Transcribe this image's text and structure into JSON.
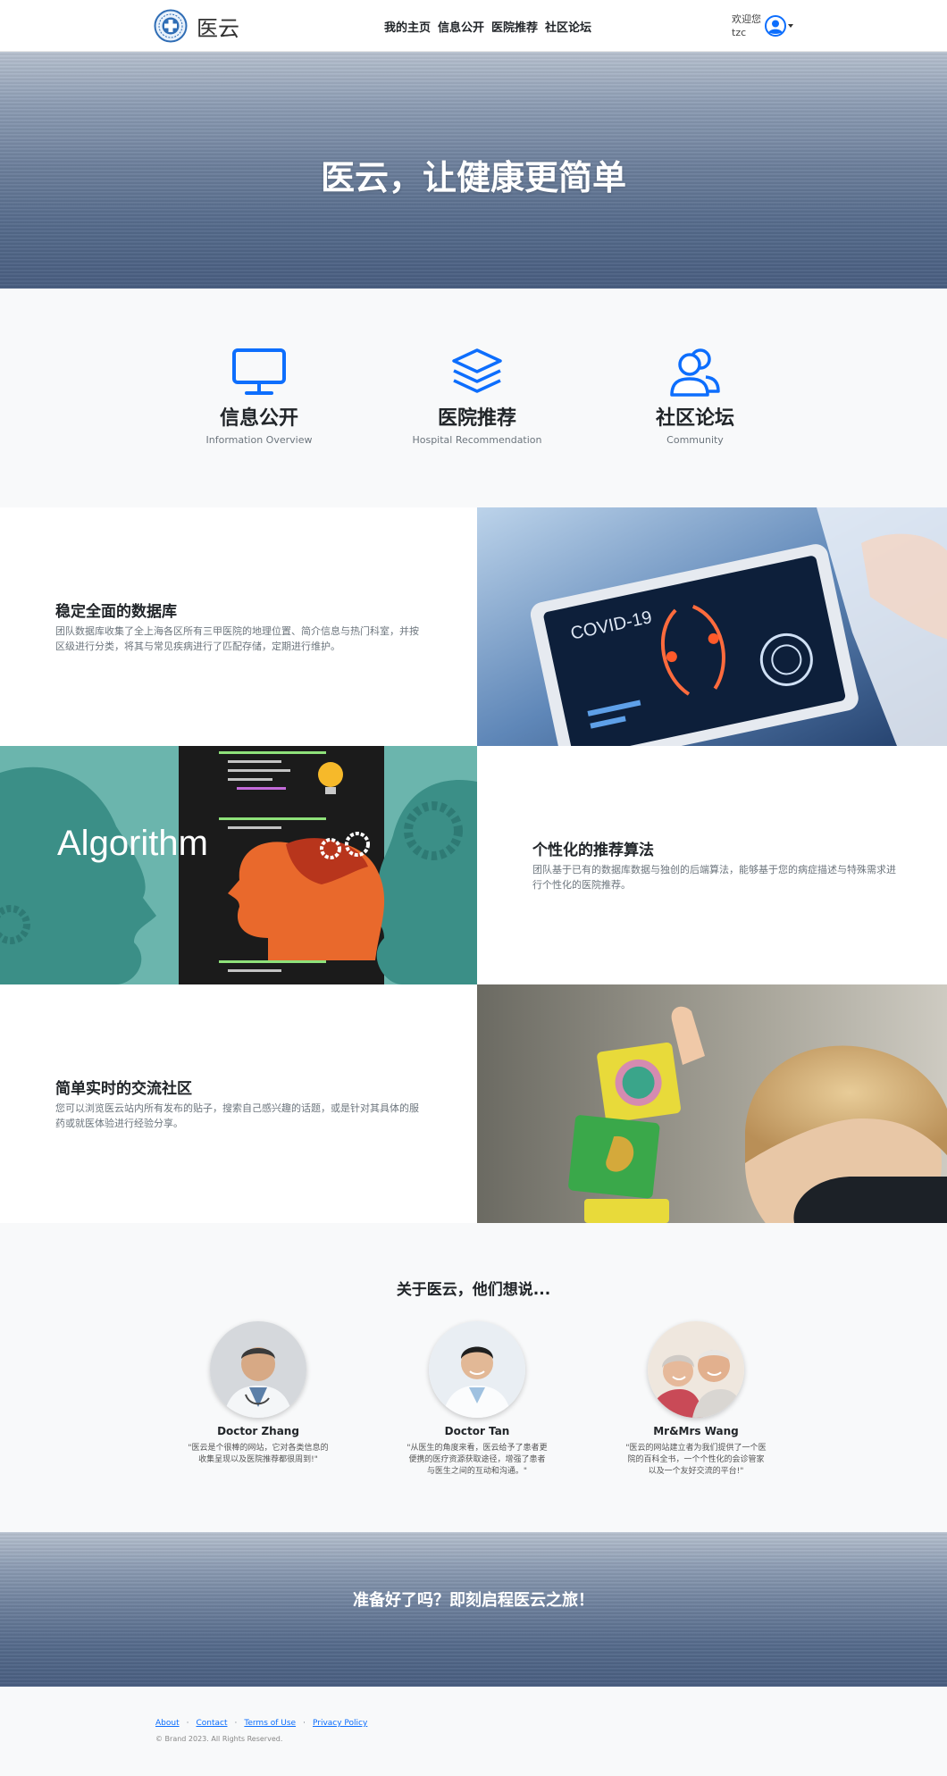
{
  "nav": {
    "brand": "医云",
    "links": [
      "我的主页",
      "信息公开",
      "医院推荐",
      "社区论坛"
    ],
    "welcome_line1": "欢迎您",
    "welcome_line2": "tzc"
  },
  "hero": {
    "title": "医云，让健康更简单"
  },
  "features": [
    {
      "icon": "monitor-icon",
      "title": "信息公开",
      "subtitle": "Information Overview"
    },
    {
      "icon": "layers-icon",
      "title": "医院推荐",
      "subtitle": "Hospital Recommendation"
    },
    {
      "icon": "people-icon",
      "title": "社区论坛",
      "subtitle": "Community"
    }
  ],
  "showcases": [
    {
      "title": "稳定全面的数据库",
      "description": "团队数据库收集了全上海各区所有三甲医院的地理位置、简介信息与热门科室，并按区级进行分类，将其与常见疾病进行了匹配存储，定期进行维护。"
    },
    {
      "title": "个性化的推荐算法",
      "description": "团队基于已有的数据库数据与独创的后端算法，能够基于您的病症描述与特殊需求进行个性化的医院推荐。",
      "image_text": "Algorithm"
    },
    {
      "title": "简单实时的交流社区",
      "description": "您可以浏览医云站内所有发布的贴子，搜索自己感兴趣的话题，或是针对其具体的服药或就医体验进行经验分享。"
    }
  ],
  "showcase_image_labels": {
    "tablet_text": "COVID-19"
  },
  "testimonials": {
    "title": "关于医云，他们想说...",
    "people": [
      {
        "name": "Doctor Zhang",
        "quote": "\"医云是个很棒的网站，它对各类信息的收集呈现以及医院推荐都很周到!\""
      },
      {
        "name": "Doctor Tan",
        "quote": "\"从医生的角度来看，医云给予了患者更便携的医疗资源获取途径，增强了患者与医生之间的互动和沟通。\""
      },
      {
        "name": "Mr&Mrs Wang",
        "quote": "\"医云的网站建立者为我们提供了一个医院的百科全书，一个个性化的会诊管家以及一个友好交流的平台!\""
      }
    ]
  },
  "cta": {
    "title": "准备好了吗？即刻启程医云之旅！"
  },
  "footer": {
    "links": [
      "About",
      "Contact",
      "Terms of Use",
      "Privacy Policy"
    ],
    "separator": "·",
    "copyright": "© Brand 2023. All Rights Reserved."
  },
  "colors": {
    "accent": "#0d6efd",
    "sea": "#6c7f9c"
  }
}
